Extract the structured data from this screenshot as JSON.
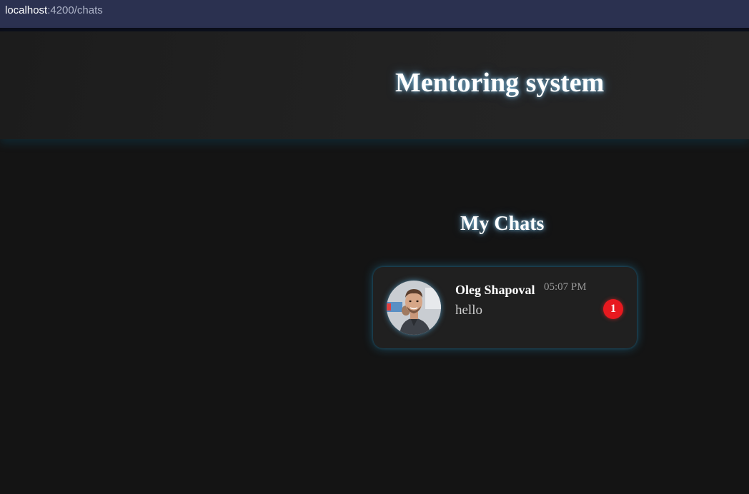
{
  "browser": {
    "url_host": "localhost",
    "url_rest": ":4200/chats"
  },
  "header": {
    "title": "Mentoring system"
  },
  "main": {
    "section_title": "My Chats",
    "chats": [
      {
        "name": "Oleg Shapoval",
        "time": "05:07 PM",
        "last_message": "hello",
        "unread_count": "1",
        "avatar_icon": "user-avatar-photo"
      }
    ]
  },
  "colors": {
    "page_background": "#141414",
    "header_background": "#232323",
    "card_background": "#202020",
    "glow": "#64beff",
    "badge": "#e8191f",
    "address_bar": "#2b3150"
  }
}
